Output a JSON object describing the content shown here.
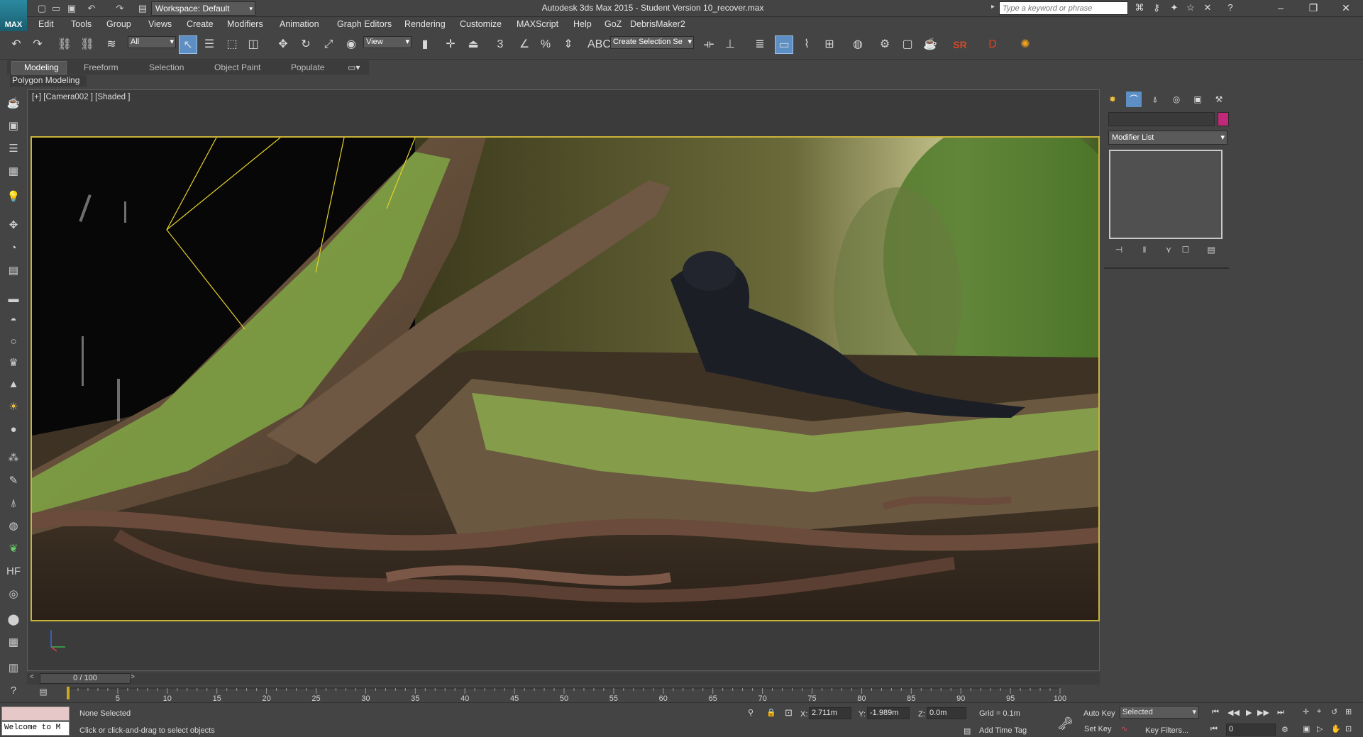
{
  "app": {
    "logo_text": "MAX",
    "window_title": "Autodesk 3ds Max  2015  - Student Version    10_recover.max"
  },
  "workspace": {
    "label": "Workspace: Default"
  },
  "search": {
    "placeholder": "Type a keyword or phrase"
  },
  "menu": [
    "Edit",
    "Tools",
    "Group",
    "Views",
    "Create",
    "Modifiers",
    "Animation",
    "Graph Editors",
    "Rendering",
    "Customize",
    "MAXScript",
    "Help",
    "GoZ",
    "DebrisMaker2"
  ],
  "toolbar": {
    "selection_filter": "All",
    "ref_coord": "View",
    "named_selection_placeholder": "Create Selection Se",
    "sr_label": "SR"
  },
  "ribbon": {
    "tabs": [
      "Modeling",
      "Freeform",
      "Selection",
      "Object Paint",
      "Populate"
    ],
    "active_tab": "Modeling",
    "panel_label": "Polygon Modeling"
  },
  "viewport": {
    "label": "[+] [Camera002 ] [Shaded ]"
  },
  "command_panel": {
    "modifier_list": "Modifier List",
    "swatch_color": "#c0287a"
  },
  "timeline": {
    "frame_display": "0 / 100",
    "ticks": [
      "5",
      "10",
      "15",
      "20",
      "25",
      "30",
      "35",
      "40",
      "45",
      "50",
      "55",
      "60",
      "65",
      "70",
      "75",
      "80",
      "85",
      "90",
      "95",
      "100"
    ]
  },
  "status": {
    "listener_text": "Welcome to M",
    "selection": "None Selected",
    "prompt": "Click or click-and-drag to select objects",
    "x_label": "X:",
    "x_value": "2.711m",
    "y_label": "Y:",
    "y_value": "-1.989m",
    "z_label": "Z:",
    "z_value": "0.0m",
    "grid": "Grid = 0.1m",
    "add_time_tag": "Add Time Tag",
    "auto_key": "Auto Key",
    "set_key": "Set Key",
    "key_mode": "Selected",
    "key_filters": "Key Filters...",
    "current_frame": "0"
  }
}
